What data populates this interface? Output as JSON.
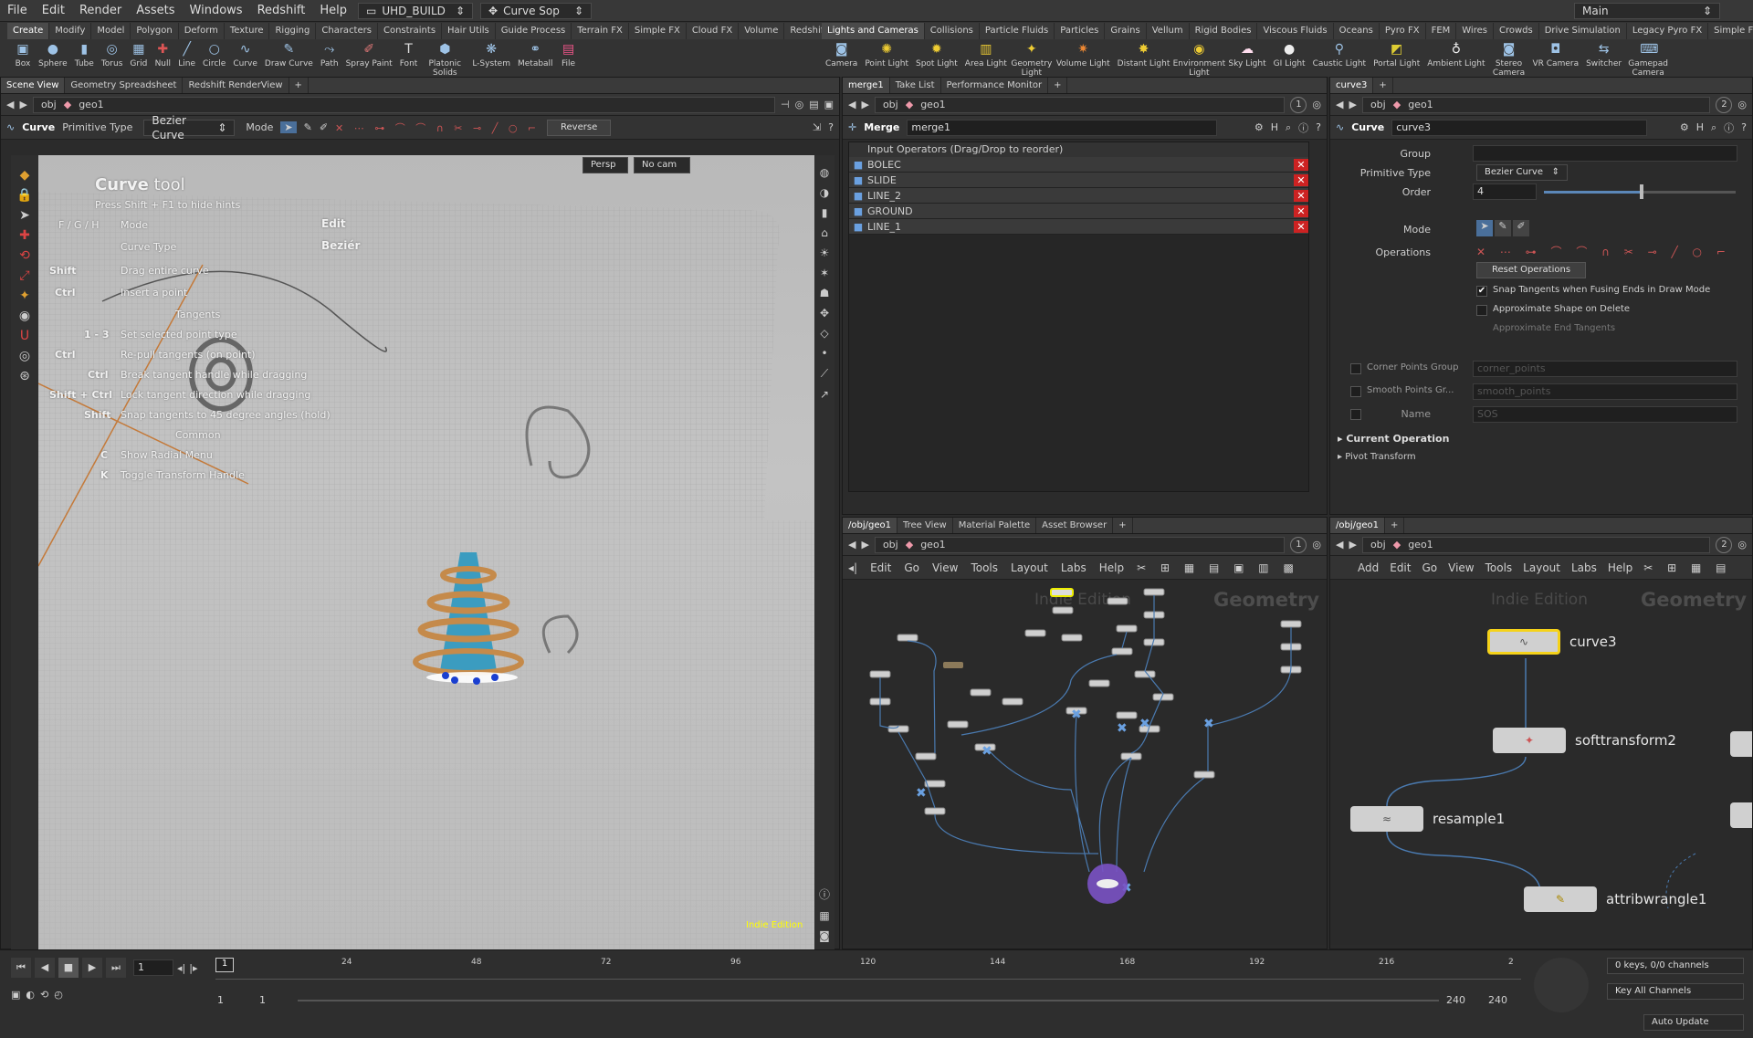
{
  "menu": {
    "items": [
      "File",
      "Edit",
      "Render",
      "Assets",
      "Windows",
      "Redshift",
      "Help"
    ],
    "desktop": "UHD_BUILD",
    "context": "Curve Sop",
    "workspace": "Main"
  },
  "shelf_left": {
    "tabs": [
      "Create",
      "Modify",
      "Model",
      "Polygon",
      "Deform",
      "Texture",
      "Rigging",
      "Characters",
      "Constraints",
      "Hair Utils",
      "Guide Process",
      "Terrain FX",
      "Simple FX",
      "Cloud FX",
      "Volume",
      "Redshift"
    ],
    "tools": [
      "Box",
      "Sphere",
      "Tube",
      "Torus",
      "Grid",
      "Null",
      "Line",
      "Circle",
      "Curve",
      "Draw Curve",
      "Path",
      "Spray Paint",
      "Font",
      "Platonic Solids",
      "L-System",
      "Metaball",
      "File"
    ]
  },
  "shelf_right": {
    "tabs": [
      "Lights and Cameras",
      "Collisions",
      "Particle Fluids",
      "Particles",
      "Grains",
      "Vellum",
      "Rigid Bodies",
      "Viscous Fluids",
      "Oceans",
      "Pyro FX",
      "FEM",
      "Wires",
      "Crowds",
      "Drive Simulation",
      "Legacy Pyro FX",
      "Simple FX"
    ],
    "tools": [
      "Camera",
      "Point Light",
      "Spot Light",
      "Area Light",
      "Geometry Light",
      "Volume Light",
      "Distant Light",
      "Environment Light",
      "Sky Light",
      "GI Light",
      "Caustic Light",
      "Portal Light",
      "Ambient Light",
      "Stereo Camera",
      "VR Camera",
      "Switcher",
      "Gamepad Camera"
    ]
  },
  "scene_pane": {
    "tabs": [
      "Scene View",
      "Geometry Spreadsheet",
      "Redshift RenderView"
    ],
    "path_root": "obj",
    "path_node": "geo1",
    "op_label": "Curve",
    "prim_type_label": "Primitive Type",
    "prim_type_value": "Bezier Curve",
    "mode_label": "Mode",
    "reverse_label": "Reverse",
    "persp": "Persp",
    "cam": "No cam",
    "watermark": "Indie Edition"
  },
  "curve_hints": {
    "title_a": "Curve",
    "title_b": " tool",
    "subtitle": "Press Shift + F1 to hide hints",
    "fgh": "F / G / H",
    "mode": "Mode",
    "mode_val": "Edit",
    "curve_type": "Curve Type",
    "curve_type_val": "Beziér",
    "rows": [
      {
        "key": "Shift",
        "text": "Drag entire curve"
      },
      {
        "key": "Ctrl",
        "text": "Insert a point"
      }
    ],
    "tangents_head": "Tangents",
    "t_rows": [
      {
        "key": "1 - 3",
        "text": "Set selected point type"
      },
      {
        "key": "Ctrl",
        "text": "Re-pull tangents (on point)"
      },
      {
        "key": "Ctrl",
        "text": "Break tangent handle while dragging"
      },
      {
        "key": "Shift + Ctrl",
        "text": "Lock tangent direction while dragging"
      },
      {
        "key": "Shift",
        "text": "Snap tangents to 45 degree angles (hold)"
      }
    ],
    "common_head": "Common",
    "c_rows": [
      {
        "key": "C",
        "text": "Show Radial Menu"
      },
      {
        "key": "K",
        "text": "Toggle Transform Handle"
      }
    ]
  },
  "merge_pane": {
    "tabs": [
      "merge1",
      "Take List",
      "Performance Monitor"
    ],
    "path_root": "obj",
    "path_node": "geo1",
    "num": "1",
    "op_label": "Merge",
    "op_name": "merge1",
    "header": "Input Operators (Drag/Drop to reorder)",
    "inputs": [
      "BOLEC",
      "SLIDE",
      "LINE_2",
      "GROUND",
      "LINE_1"
    ]
  },
  "curve_pane": {
    "tabs": [
      "curve3"
    ],
    "path_root": "obj",
    "path_node": "geo1",
    "num": "2",
    "op_label": "Curve",
    "op_name": "curve3",
    "group_label": "Group",
    "prim_label": "Primitive Type",
    "prim_value": "Bezier Curve",
    "order_label": "Order",
    "order_value": "4",
    "order_fraction": 0.5,
    "mode_label": "Mode",
    "ops_label": "Operations",
    "reset_label": "Reset Operations",
    "chk1": "Snap Tangents when Fusing Ends in Draw Mode",
    "chk2": "Approximate Shape on Delete",
    "chk3": "Approximate End Tangents",
    "corner_label": "Corner Points Group",
    "corner_ph": "corner_points",
    "smooth_label": "Smooth Points Gr...",
    "smooth_ph": "smooth_points",
    "name_label": "Name",
    "name_ph": "SOS",
    "current_op": "Current Operation",
    "pivot": "Pivot Transform"
  },
  "net_mid": {
    "tabs": [
      "/obj/geo1",
      "Tree View",
      "Material Palette",
      "Asset Browser"
    ],
    "path_root": "obj",
    "path_node": "geo1",
    "num": "1",
    "menu": [
      "Edit",
      "Go",
      "View",
      "Tools",
      "Layout",
      "Labs",
      "Help"
    ],
    "indie": "Indie Edition",
    "context": "Geometry"
  },
  "net_right": {
    "tabs": [
      "/obj/geo1"
    ],
    "path_root": "obj",
    "path_node": "geo1",
    "num": "2",
    "menu": [
      "Add",
      "Edit",
      "Go",
      "View",
      "Tools",
      "Layout",
      "Labs",
      "Help"
    ],
    "indie": "Indie Edition",
    "context": "Geometry",
    "nodes": [
      "curve3",
      "softtransform2",
      "resample1",
      "attribwrangle1"
    ]
  },
  "timeline": {
    "frame": "1",
    "ticks": [
      "1",
      "24",
      "48",
      "72",
      "96",
      "120",
      "144",
      "168",
      "192",
      "216",
      "2"
    ],
    "start": "1",
    "start2": "1",
    "end": "240",
    "end2": "240",
    "keys": "0 keys, 0/0 channels",
    "key_all": "Key All Channels",
    "auto_update": "Auto Update"
  }
}
